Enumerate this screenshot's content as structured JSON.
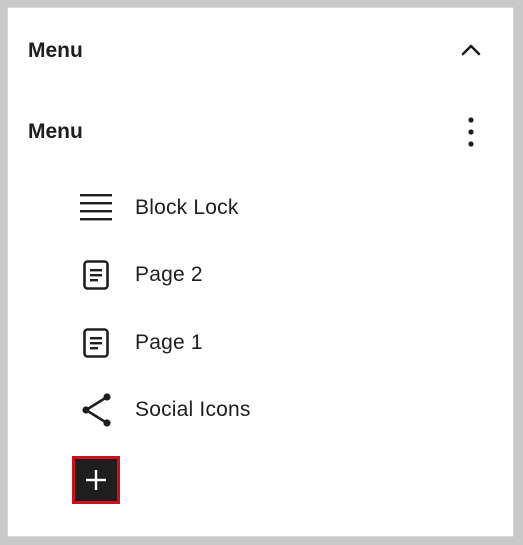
{
  "header": {
    "title": "Menu",
    "collapse_icon": "chevron-up-icon"
  },
  "menu_block": {
    "title": "Menu",
    "options_icon": "more-vertical-icon"
  },
  "items": [
    {
      "label": "Block Lock",
      "icon": "list-lines-icon"
    },
    {
      "label": "Page 2",
      "icon": "page-icon"
    },
    {
      "label": "Page 1",
      "icon": "page-icon"
    },
    {
      "label": "Social Icons",
      "icon": "share-icon"
    }
  ],
  "add_button": {
    "icon": "plus-icon"
  },
  "colors": {
    "text": "#1e1e1e",
    "add_button_bg": "#1e1e1e",
    "highlight_border": "#d10e1b",
    "panel_bg": "#ffffff",
    "frame": "#c9c9c9"
  }
}
